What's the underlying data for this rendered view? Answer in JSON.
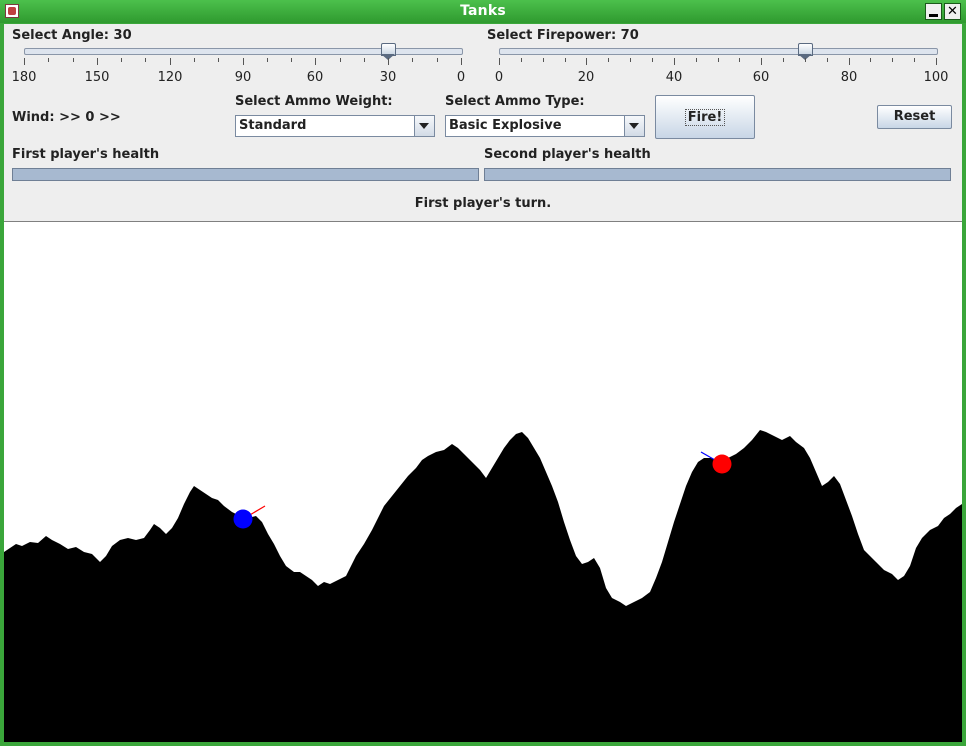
{
  "window": {
    "title": "Tanks"
  },
  "controls": {
    "angle": {
      "label": "Select Angle: 30",
      "value": 30,
      "min": 0,
      "max": 180,
      "inverted": true,
      "ticks": [
        "180",
        "150",
        "120",
        "90",
        "60",
        "30",
        "0"
      ]
    },
    "firepower": {
      "label": "Select Firepower: 70",
      "value": 70,
      "min": 0,
      "max": 100,
      "ticks": [
        "0",
        "20",
        "40",
        "60",
        "80",
        "100"
      ]
    },
    "wind": "Wind: >> 0 >>",
    "ammo_weight": {
      "label": "Select Ammo Weight:",
      "selected": "Standard"
    },
    "ammo_type": {
      "label": "Select Ammo Type:",
      "selected": "Basic Explosive"
    },
    "fire_label": "Fire!",
    "reset_label": "Reset"
  },
  "health": {
    "player1_label": "First player's health",
    "player2_label": "Second player's health",
    "player1_level": 1.0,
    "player2_level": 1.0
  },
  "status": "First player's turn.",
  "colors": {
    "player1": "#0000ff",
    "player2": "#ff0000",
    "terrain": "#000000",
    "sky": "#ffffff"
  }
}
